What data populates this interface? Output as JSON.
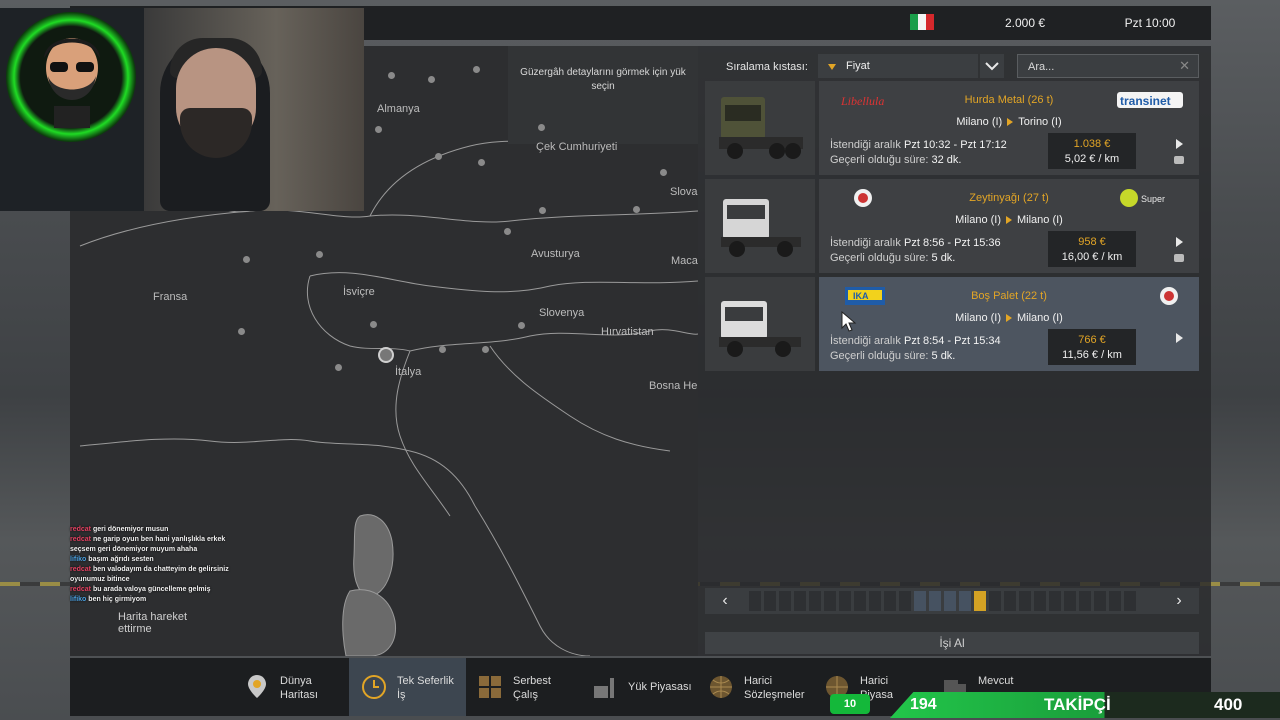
{
  "topbar": {
    "money": "2.000 €",
    "time": "Pzt 10:00"
  },
  "map": {
    "hint": "Güzergâh detaylarını görmek için yük seçin",
    "labels": [
      "Almanya",
      "Çek Cumhuriyeti",
      "Slova",
      "Avusturya",
      "Maca",
      "Fransa",
      "İsviçre",
      "Slovenya",
      "Hırvatistan",
      "İtalya",
      "Bosna Her"
    ]
  },
  "sort": {
    "label": "Sıralama kıstası:",
    "value": "Fiyat",
    "search_placeholder": "Ara..."
  },
  "jobs": [
    {
      "logo_left": "Libellula",
      "cargo": "Hurda Metal (26 t)",
      "logo_right": "transinet",
      "from": "Milano (I)",
      "to": "Torino (I)",
      "range_label": "İstendiği aralık",
      "range": "Pzt 10:32 - Pzt 17:12",
      "valid_label": "Geçerli olduğu süre:",
      "valid": "32 dk.",
      "price": "1.038 €",
      "per_km": "5,02 € / km"
    },
    {
      "logo_left": "",
      "cargo": "Zeytinyağı (27 t)",
      "logo_right": "Super",
      "from": "Milano (I)",
      "to": "Milano (I)",
      "range_label": "İstendiği aralık",
      "range": "Pzt 8:56 - Pzt 15:36",
      "valid_label": "Geçerli olduğu süre:",
      "valid": "5 dk.",
      "price": "958 €",
      "per_km": "16,00 € / km"
    },
    {
      "logo_left": "IKA",
      "cargo": "Boş Palet (22 t)",
      "logo_right": "",
      "from": "Milano (I)",
      "to": "Milano (I)",
      "range_label": "İstendiği aralık",
      "range": "Pzt 8:54 - Pzt 15:34",
      "valid_label": "Geçerli olduğu süre:",
      "valid": "5 dk.",
      "price": "766 €",
      "per_km": "11,56 € / km"
    }
  ],
  "pager": {
    "prev": "‹",
    "next": "›",
    "segments": 26,
    "current": 15
  },
  "accept_label": "İşi Al",
  "tabs": [
    {
      "label": "Dünya Haritası",
      "icon": "world-map-icon"
    },
    {
      "label": "Tek Seferlik İş",
      "icon": "clock-icon"
    },
    {
      "label": "Serbest Çalış",
      "icon": "boxes-icon"
    },
    {
      "label": "Yük Piyasası",
      "icon": "cargo-market-icon"
    },
    {
      "label": "Harici Sözleşmeler",
      "icon": "globe-icon"
    },
    {
      "label": "Harici Piyasa",
      "icon": "globe-icon"
    },
    {
      "label": "Mevcut",
      "icon": "truck-icon"
    }
  ],
  "chat": [
    {
      "user": "redcat",
      "msg": "geri dönemiyor musun"
    },
    {
      "user": "redcat",
      "msg": "ne garip oyun ben hani yanlışlıkla erkek seçsem geri dönemiyor muyum ahaha"
    },
    {
      "user": "lifiko",
      "msg": "başım ağrıdı sesten"
    },
    {
      "user": "redcat",
      "msg": "ben valodayım da chatteyim de gelirsiniz oyunumuz bitince"
    },
    {
      "user": "redcat",
      "msg": "bu arada valoya güncelleme gelmiş"
    },
    {
      "user": "lifiko",
      "msg": "ben hiç girmiyom"
    }
  ],
  "overlay_text": "Harita hareket ettirme",
  "followers": {
    "badge": "10",
    "count": "194",
    "label": "TAKİPÇİ",
    "goal": "400"
  },
  "colors": {
    "accent": "#e2a526",
    "panel": "#3e4043",
    "selected": "#4d5560",
    "follow_green": "#22c64a"
  }
}
